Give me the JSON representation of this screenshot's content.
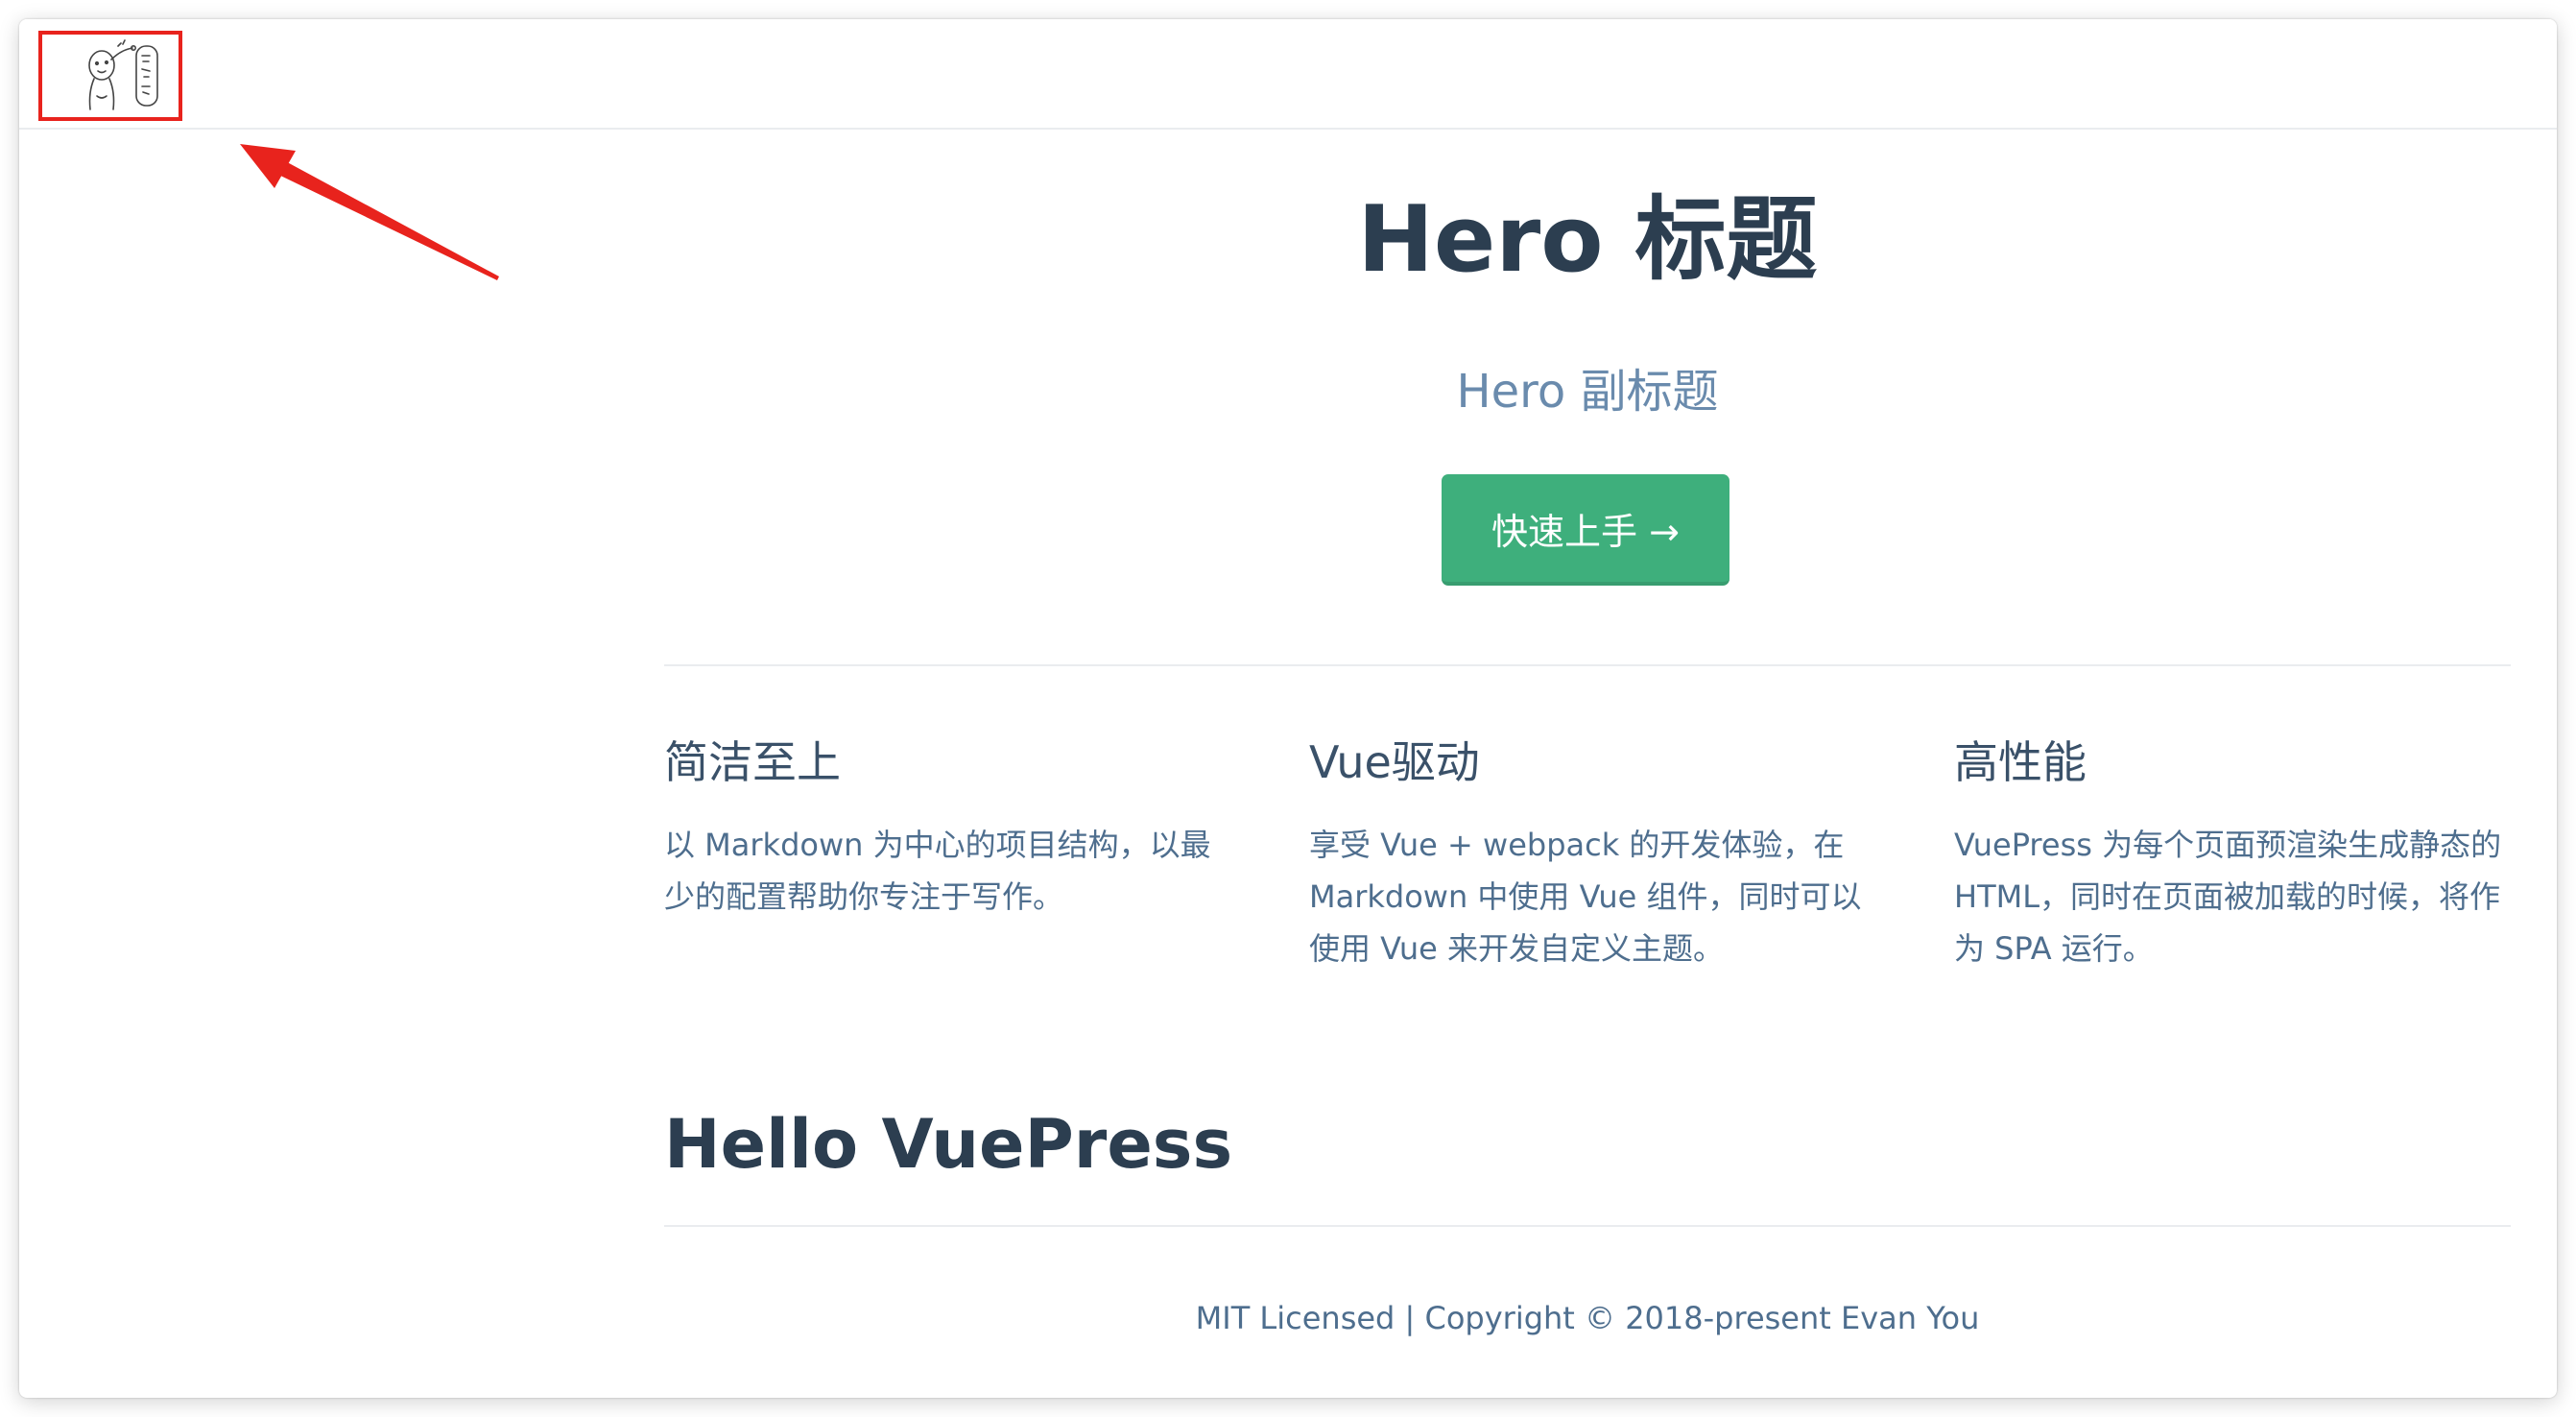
{
  "hero": {
    "title": "Hero 标题",
    "subtitle": "Hero 副标题",
    "action_label": "快速上手 →"
  },
  "features": [
    {
      "title": "简洁至上",
      "details_lines": [
        "以 Markdown 为中心的项目结构，以最",
        "少的配置帮助你专注于写作。"
      ]
    },
    {
      "title": "Vue驱动",
      "details_lines": [
        "享受 Vue + webpack 的开发体验，在",
        "Markdown 中使用 Vue 组件，同时可以",
        "使用 Vue 来开发自定义主题。"
      ]
    },
    {
      "title": "高性能",
      "details_lines": [
        "VuePress 为每个页面预渲染生成静态的",
        "HTML，同时在页面被加载的时候，将作",
        "为 SPA 运行。"
      ]
    }
  ],
  "content": {
    "heading": "Hello VuePress"
  },
  "footer": {
    "text": "MIT Licensed | Copyright © 2018-present Evan You"
  },
  "colors": {
    "accent": "#3eaf7c",
    "annotation": "#e8231d",
    "text": "#2c3e50",
    "subtitle": "#6a8bad"
  },
  "icons": {
    "logo": "hand-drawn-logo-icon",
    "annotation_arrow": "arrow-icon"
  }
}
